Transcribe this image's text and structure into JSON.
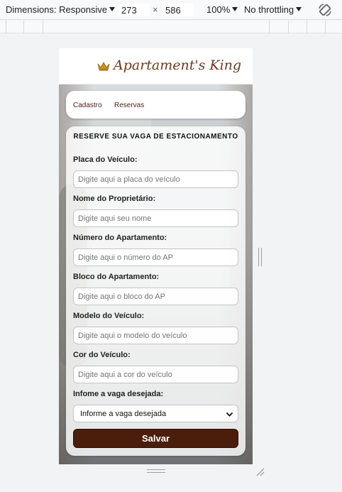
{
  "devtools": {
    "dimensions_label": "Dimensions: Responsive",
    "width_value": "273",
    "height_value": "586",
    "times": "×",
    "zoom": "100%",
    "throttling": "No throttling",
    "icons": {
      "caret": "caret-down-icon",
      "rotate": "rotate-icon",
      "resize": "resize-corner-icon"
    }
  },
  "app": {
    "brand": "Apartament's King",
    "brand_color": "#6b3a1e",
    "accent_color": "#4b1d0b",
    "nav": [
      {
        "label": "Cadastro"
      },
      {
        "label": "Reservas"
      }
    ],
    "form": {
      "title": "RESERVE SUA VAGA DE ESTACIONAMENTO",
      "fields": [
        {
          "label": "Placa do Veículo:",
          "placeholder": "Digite aqui a placa do veículo"
        },
        {
          "label": "Nome do Proprietário:",
          "placeholder": "Digite aqui seu nome"
        },
        {
          "label": "Número do Apartamento:",
          "placeholder": "Digite aqui o número do AP"
        },
        {
          "label": "Bloco do Apartamento:",
          "placeholder": "Digite aqui o bloco do AP"
        },
        {
          "label": "Modelo do Veículo:",
          "placeholder": "Digite aqui o modelo do veículo"
        },
        {
          "label": "Cor do Veículo:",
          "placeholder": "Digite aqui a cor do veículo"
        }
      ],
      "vaga": {
        "label": "Infome a vaga desejada:",
        "selected": "Informe a vaga desejada"
      },
      "save_label": "Salvar"
    }
  }
}
